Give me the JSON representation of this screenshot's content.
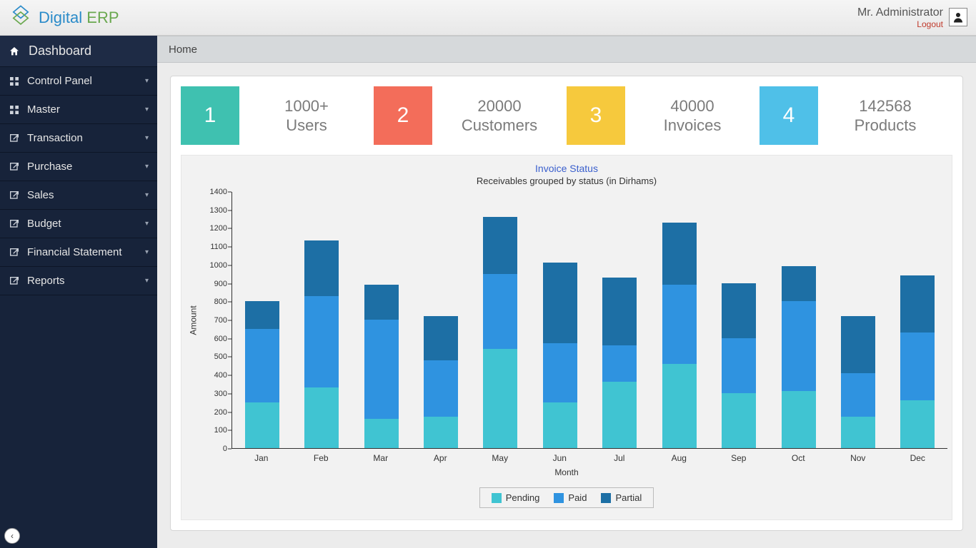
{
  "brand": {
    "first": "Digital",
    "second": "ERP"
  },
  "user": {
    "name": "Mr. Administrator",
    "logout": "Logout"
  },
  "sidebar": {
    "dashboard": "Dashboard",
    "items": [
      {
        "label": "Control Panel"
      },
      {
        "label": "Master"
      },
      {
        "label": "Transaction"
      },
      {
        "label": "Purchase"
      },
      {
        "label": "Sales"
      },
      {
        "label": "Budget"
      },
      {
        "label": "Financial Statement"
      },
      {
        "label": "Reports"
      }
    ]
  },
  "breadcrumb": "Home",
  "stats": [
    {
      "num": "1",
      "value": "1000+",
      "label": "Users",
      "color": "c1"
    },
    {
      "num": "2",
      "value": "20000",
      "label": "Customers",
      "color": "c2"
    },
    {
      "num": "3",
      "value": "40000",
      "label": "Invoices",
      "color": "c3"
    },
    {
      "num": "4",
      "value": "142568",
      "label": "Products",
      "color": "c4"
    }
  ],
  "chart": {
    "title": "Invoice Status",
    "subtitle": "Receivables grouped by status (in Dirhams)",
    "xlabel": "Month",
    "ylabel": "Amount",
    "legend": {
      "pending": "Pending",
      "paid": "Paid",
      "partial": "Partial"
    }
  },
  "chart_data": {
    "type": "bar",
    "stacked": true,
    "categories": [
      "Jan",
      "Feb",
      "Mar",
      "Apr",
      "May",
      "Jun",
      "Jul",
      "Aug",
      "Sep",
      "Oct",
      "Nov",
      "Dec"
    ],
    "series": [
      {
        "name": "Pending",
        "values": [
          250,
          330,
          160,
          170,
          540,
          250,
          360,
          460,
          300,
          310,
          170,
          260
        ]
      },
      {
        "name": "Paid",
        "values": [
          400,
          500,
          540,
          310,
          410,
          320,
          200,
          430,
          300,
          490,
          240,
          370
        ]
      },
      {
        "name": "Partial",
        "values": [
          150,
          300,
          190,
          240,
          310,
          440,
          370,
          340,
          300,
          190,
          310,
          310
        ]
      }
    ],
    "xlabel": "Month",
    "ylabel": "Amount",
    "ylim": [
      0,
      1400
    ],
    "yticks": [
      0,
      100,
      200,
      300,
      400,
      500,
      600,
      700,
      800,
      900,
      1000,
      1100,
      1200,
      1300,
      1400
    ],
    "title": "Invoice Status",
    "subtitle": "Receivables grouped by status (in Dirhams)",
    "legend_position": "bottom"
  }
}
